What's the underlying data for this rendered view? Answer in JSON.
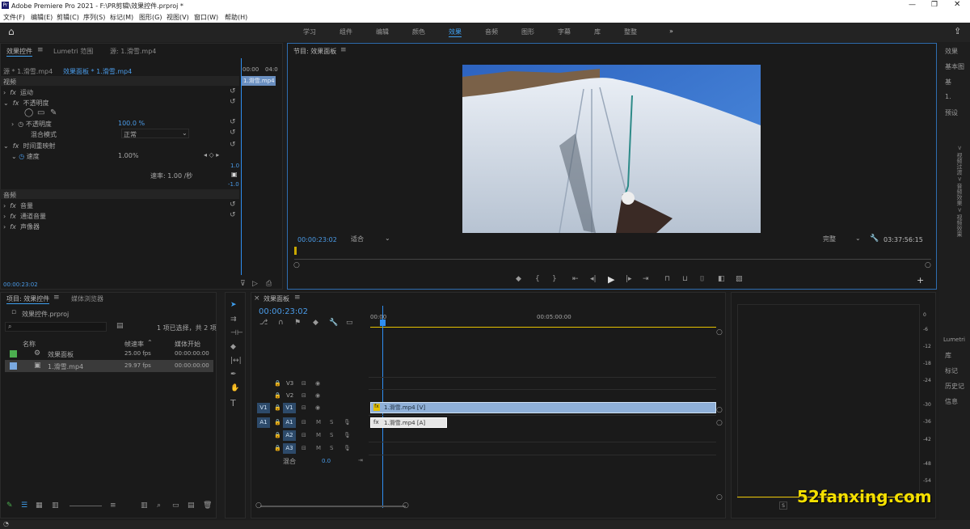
{
  "window": {
    "title": "Adobe Premiere Pro 2021 - F:\\PR剪辑\\效果控件.prproj *"
  },
  "menu": [
    "文件(F)",
    "编辑(E)",
    "剪辑(C)",
    "序列(S)",
    "标记(M)",
    "图形(G)",
    "视图(V)",
    "窗口(W)",
    "帮助(H)"
  ],
  "workspaces": [
    "学习",
    "组件",
    "编辑",
    "颜色",
    "效果",
    "音频",
    "图形",
    "字幕",
    "库",
    "整整"
  ],
  "active_workspace": "效果",
  "more_workspaces": "»",
  "effect_controls": {
    "tabs": [
      "效果控件",
      "Lumetri 范围",
      "源: 1.滑雪.mp4"
    ],
    "source_label": "源 * 1.滑雪.mp4",
    "seq_label": "效果面板 * 1.滑雪.mp4",
    "video_header": "视频",
    "motion": "运动",
    "opacity": "不透明度",
    "opacity_prop": "不透明度",
    "opacity_val": "100.0 %",
    "blend_label": "混合模式",
    "blend_val": "正常",
    "time_remap": "时间重映射",
    "speed": "速度",
    "speed_val": "1.00%",
    "rate_label": "速率: 1.00 /秒",
    "graph_top": "1.0",
    "graph_bottom": "-1.0",
    "audio_header": "音频",
    "volume": "音量",
    "channel_volume": "通道音量",
    "panner": "声像器",
    "mini_times": [
      "00:00",
      "04:0"
    ],
    "mini_clip": "1.滑雪.mp4",
    "timecode": "00:00:23:02"
  },
  "program": {
    "title": "节目: 效果面板",
    "timecode": "00:00:23:02",
    "fit": "适合",
    "quality": "完整",
    "duration": "03:37:56:15"
  },
  "project": {
    "tabs": [
      "项目: 效果控件",
      "媒体浏览器"
    ],
    "file": "效果控件.prproj",
    "selection": "1 项已选择，共 2 项",
    "cols": [
      "名称",
      "帧速率",
      "媒体开始"
    ],
    "rows": [
      {
        "name": "效果面板",
        "fps": "25.00 fps",
        "start": "00:00:00:00",
        "color": "#4caf50"
      },
      {
        "name": "1.滑雪.mp4",
        "fps": "29.97 fps",
        "start": "00:00:00:00",
        "color": "#7aa9e0"
      }
    ]
  },
  "timeline": {
    "title": "效果面板",
    "timecode": "00:00:23:02",
    "ruler": [
      "00:00",
      "00:05:00:00"
    ],
    "video_tracks": [
      "V3",
      "V2",
      "V1"
    ],
    "audio_tracks": [
      "A1",
      "A2",
      "A3"
    ],
    "mix_label": "混合",
    "mix_val": "0.0",
    "v_src": "V1",
    "a_src": "A1",
    "clip_v": "1.滑雪.mp4 [V]",
    "clip_a": "1.滑雪.mp4 [A]",
    "ms": [
      "M",
      "S"
    ]
  },
  "meter": {
    "scale": [
      "0",
      "-6",
      "-12",
      "-18",
      "-24",
      "-30",
      "-36",
      "-42",
      "-48",
      "-54"
    ],
    "solo": "S"
  },
  "right_panel": [
    "效果",
    "基本图",
    "基",
    "1.",
    "预设",
    "Lumetri",
    "库",
    "标记",
    "历史记",
    "信息"
  ],
  "right_vertical": "> 视频过渡 > 音频效果 > 视频效果",
  "watermark": "52fanxing.com",
  "colors": {
    "accent": "#3fa0f0",
    "clip": "#8fb0d8",
    "playhead": "#2f8ef0",
    "workarea": "#e6c200"
  }
}
